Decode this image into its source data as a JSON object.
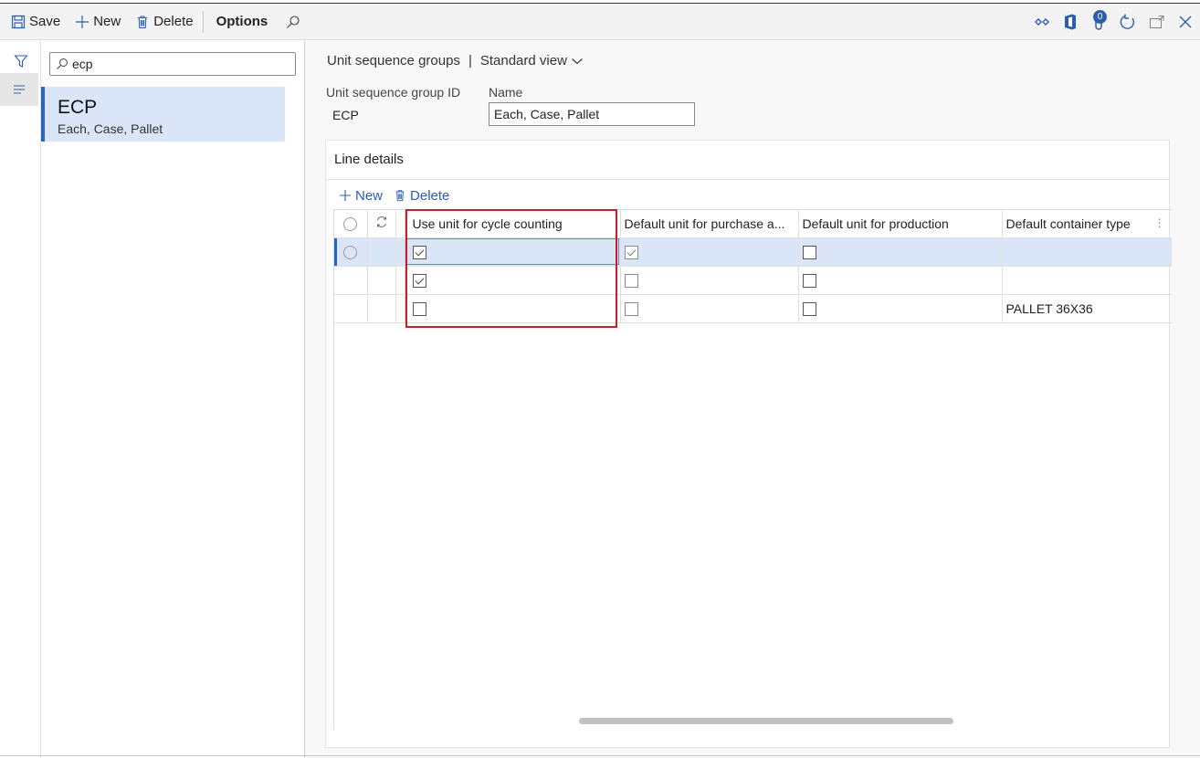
{
  "action_pane": {
    "save_label": "Save",
    "new_label": "New",
    "delete_label": "Delete",
    "options_label": "Options",
    "notification_count": "0"
  },
  "list_pane": {
    "search_value": "ecp",
    "items": [
      {
        "title": "ECP",
        "subtitle": "Each, Case, Pallet"
      }
    ]
  },
  "header": {
    "page_title": "Unit sequence groups",
    "separator": "|",
    "view_name": "Standard view"
  },
  "fields": {
    "group_id_label": "Unit sequence group ID",
    "group_id_value": "ECP",
    "name_label": "Name",
    "name_value": "Each, Case, Pallet"
  },
  "line_details": {
    "title": "Line details",
    "new_label": "New",
    "delete_label": "Delete",
    "columns": [
      "Use unit for cycle counting",
      "Default unit for purchase a...",
      "Default unit for production",
      "Default container type"
    ],
    "rows": [
      {
        "cycle": true,
        "purchase": true,
        "production": false,
        "container": ""
      },
      {
        "cycle": true,
        "purchase": false,
        "production": false,
        "container": ""
      },
      {
        "cycle": false,
        "purchase": false,
        "production": false,
        "container": "PALLET 36X36"
      }
    ]
  },
  "colors": {
    "accent": "#2b62c9",
    "selected_row": "#dbe5f8",
    "highlight_box": "#c81e25"
  }
}
